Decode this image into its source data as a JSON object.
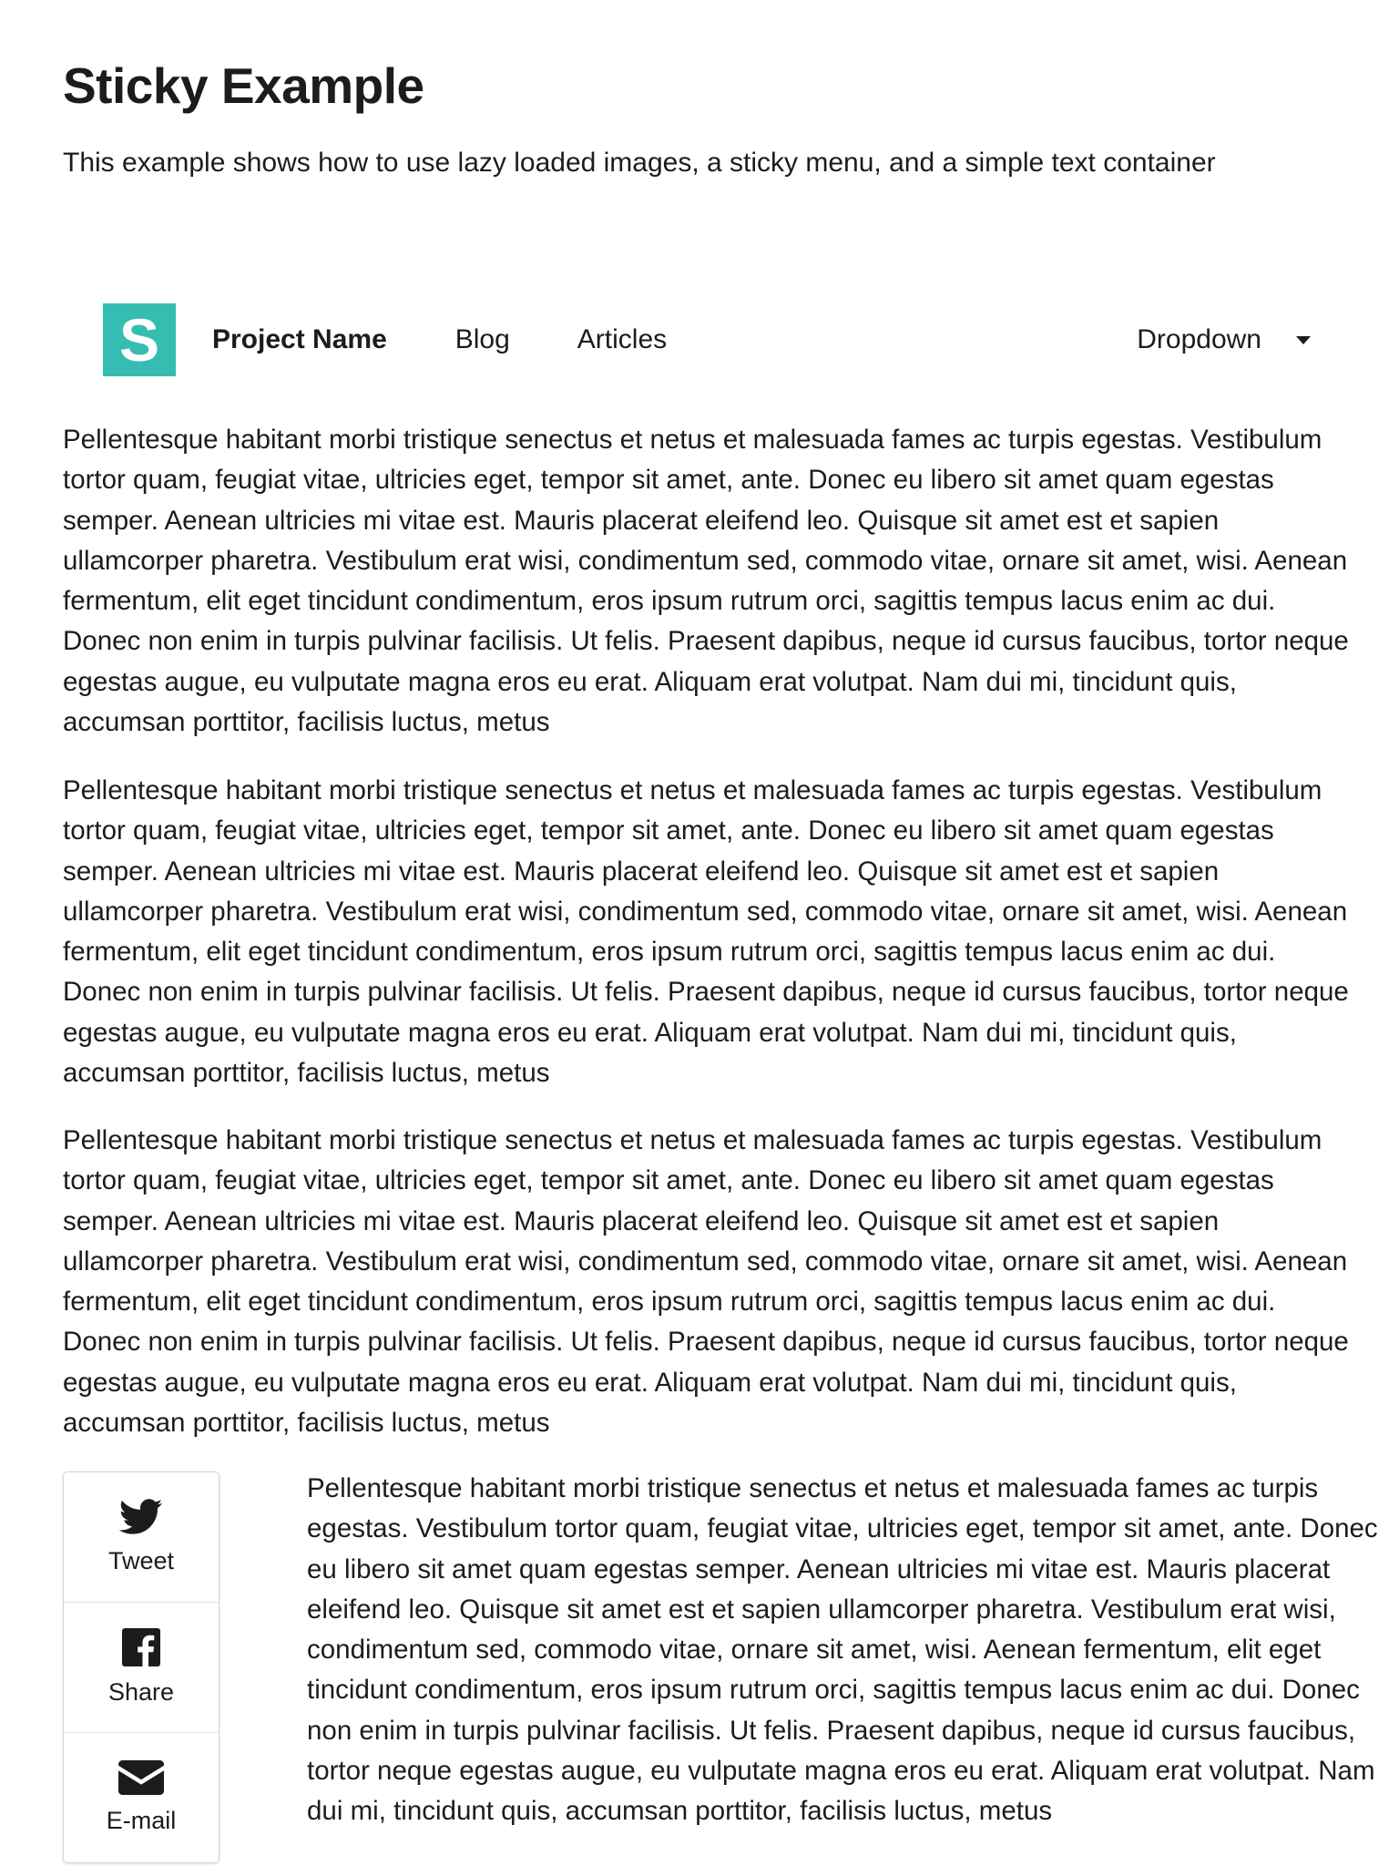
{
  "header": {
    "title": "Sticky Example",
    "subtitle": "This example shows how to use lazy loaded images, a sticky menu, and a simple text container"
  },
  "menu": {
    "logo_letter": "S",
    "logo_color": "#35bdb2",
    "brand": "Project Name",
    "items": [
      "Blog",
      "Articles"
    ],
    "dropdown_label": "Dropdown"
  },
  "paragraphs": [
    "Pellentesque habitant morbi tristique senectus et netus et malesuada fames ac turpis egestas. Vestibulum tortor quam, feugiat vitae, ultricies eget, tempor sit amet, ante. Donec eu libero sit amet quam egestas semper. Aenean ultricies mi vitae est. Mauris placerat eleifend leo. Quisque sit amet est et sapien ullamcorper pharetra. Vestibulum erat wisi, condimentum sed, commodo vitae, ornare sit amet, wisi. Aenean fermentum, elit eget tincidunt condimentum, eros ipsum rutrum orci, sagittis tempus lacus enim ac dui. Donec non enim in turpis pulvinar facilisis. Ut felis. Praesent dapibus, neque id cursus faucibus, tortor neque egestas augue, eu vulputate magna eros eu erat. Aliquam erat volutpat. Nam dui mi, tincidunt quis, accumsan porttitor, facilisis luctus, metus",
    "Pellentesque habitant morbi tristique senectus et netus et malesuada fames ac turpis egestas. Vestibulum tortor quam, feugiat vitae, ultricies eget, tempor sit amet, ante. Donec eu libero sit amet quam egestas semper. Aenean ultricies mi vitae est. Mauris placerat eleifend leo. Quisque sit amet est et sapien ullamcorper pharetra. Vestibulum erat wisi, condimentum sed, commodo vitae, ornare sit amet, wisi. Aenean fermentum, elit eget tincidunt condimentum, eros ipsum rutrum orci, sagittis tempus lacus enim ac dui. Donec non enim in turpis pulvinar facilisis. Ut felis. Praesent dapibus, neque id cursus faucibus, tortor neque egestas augue, eu vulputate magna eros eu erat. Aliquam erat volutpat. Nam dui mi, tincidunt quis, accumsan porttitor, facilisis luctus, metus",
    "Pellentesque habitant morbi tristique senectus et netus et malesuada fames ac turpis egestas. Vestibulum tortor quam, feugiat vitae, ultricies eget, tempor sit amet, ante. Donec eu libero sit amet quam egestas semper. Aenean ultricies mi vitae est. Mauris placerat eleifend leo. Quisque sit amet est et sapien ullamcorper pharetra. Vestibulum erat wisi, condimentum sed, commodo vitae, ornare sit amet, wisi. Aenean fermentum, elit eget tincidunt condimentum, eros ipsum rutrum orci, sagittis tempus lacus enim ac dui. Donec non enim in turpis pulvinar facilisis. Ut felis. Praesent dapibus, neque id cursus faucibus, tortor neque egestas augue, eu vulputate magna eros eu erat. Aliquam erat volutpat. Nam dui mi, tincidunt quis, accumsan porttitor, facilisis luctus, metus",
    "Pellentesque habitant morbi tristique senectus et netus et malesuada fames ac turpis egestas. Vestibulum tortor quam, feugiat vitae, ultricies eget, tempor sit amet, ante. Donec eu libero sit amet quam egestas semper. Aenean ultricies mi vitae est. Mauris placerat eleifend leo. Quisque sit amet est et sapien ullamcorper pharetra. Vestibulum erat wisi, condimentum sed, commodo vitae, ornare sit amet, wisi. Aenean fermentum, elit eget tincidunt condimentum, eros ipsum rutrum orci, sagittis tempus lacus enim ac dui. Donec non enim in turpis pulvinar facilisis. Ut felis. Praesent dapibus, neque id cursus faucibus, tortor neque egestas augue, eu vulputate magna eros eu erat. Aliquam erat volutpat. Nam dui mi, tincidunt quis, accumsan porttitor, facilisis luctus, metus"
  ],
  "share": {
    "items": [
      {
        "label": "Tweet",
        "icon": "twitter-icon"
      },
      {
        "label": "Share",
        "icon": "facebook-icon"
      },
      {
        "label": "E-mail",
        "icon": "mail-icon"
      }
    ]
  }
}
